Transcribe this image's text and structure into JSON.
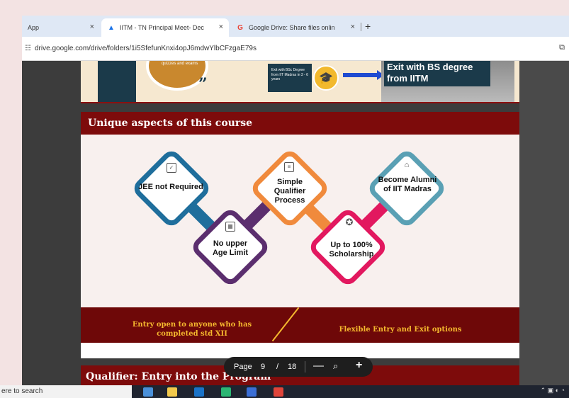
{
  "browser": {
    "tabs": [
      {
        "title": "App",
        "close": "×"
      },
      {
        "title": "IITM - TN Principal Meet- Dec",
        "close": "×"
      },
      {
        "title": "Google Drive: Share files onlin",
        "close": "×"
      }
    ],
    "new_tab": "+",
    "url": "drive.google.com/drive/folders/1i5SfefunKnxi4opJ6mdwYlbCFzgaE79s"
  },
  "top_slide": {
    "circle_text": "quizzes and exams",
    "quote_mark": "”",
    "box_text": "Exit with BSc Degree from IIT Madras in 3 - 6 years",
    "exit_text": "Exit with BS degree from IITM"
  },
  "slide": {
    "header": "Unique aspects of this course",
    "features": [
      {
        "label": "JEE not Required",
        "color": "#1f6e9c"
      },
      {
        "label": "No upper Age Limit",
        "color": "#5b2e6e"
      },
      {
        "label": "Simple Qualifier Process",
        "color": "#f08a3c"
      },
      {
        "label": "Up to 100% Scholarship",
        "color": "#e2185f"
      },
      {
        "label": "Become Alumni of IIT Madras",
        "color": "#5aa0b4"
      }
    ],
    "bottom_left": "Entry open to  anyone who  has completed  std XII",
    "bottom_right": "Flexible Entry and Exit options",
    "next_title": "Qualifier: Entry into the Program"
  },
  "pager": {
    "label": "Page",
    "current": "9",
    "separator": "/",
    "total": "18",
    "minus": "—",
    "zoom_icon": "⌕",
    "plus": "+"
  },
  "taskbar": {
    "search_placeholder": "ere to search"
  }
}
